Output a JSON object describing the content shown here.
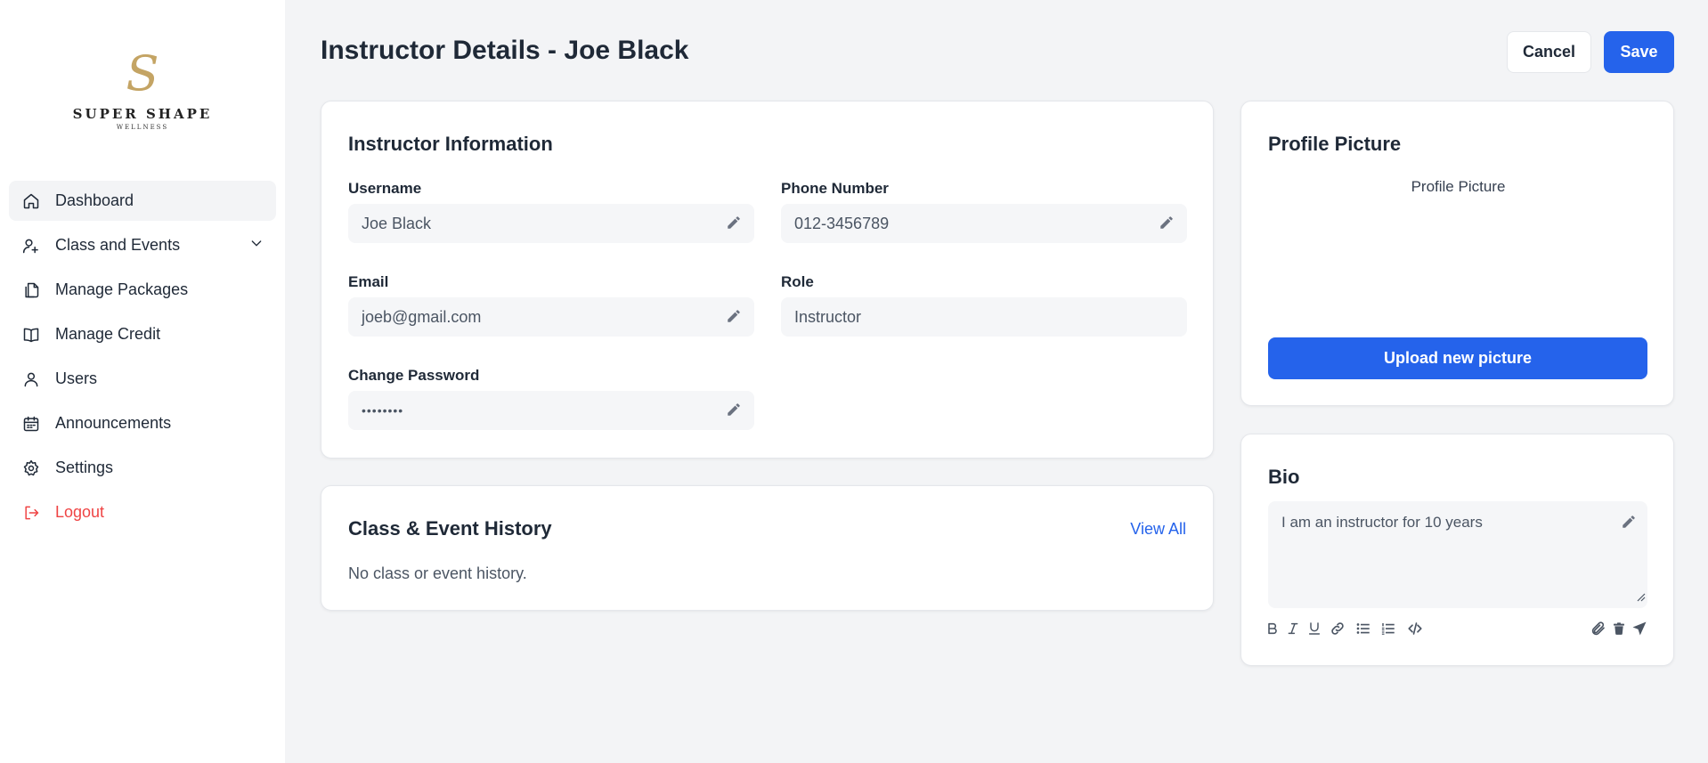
{
  "brand": {
    "mark": "S",
    "name": "SUPER SHAPE",
    "sub": "WELLNESS",
    "gold": "#c4a464"
  },
  "sidebar": {
    "items": [
      {
        "label": "Dashboard",
        "icon": "home-icon"
      },
      {
        "label": "Class and Events",
        "icon": "user-plus-icon"
      },
      {
        "label": "Manage Packages",
        "icon": "documents-icon"
      },
      {
        "label": "Manage Credit",
        "icon": "book-icon"
      },
      {
        "label": "Users",
        "icon": "user-icon"
      },
      {
        "label": "Announcements",
        "icon": "calendar-icon"
      },
      {
        "label": "Settings",
        "icon": "gear-icon"
      },
      {
        "label": "Logout",
        "icon": "logout-icon"
      }
    ]
  },
  "header": {
    "title": "Instructor Details - Joe Black",
    "cancel_label": "Cancel",
    "save_label": "Save"
  },
  "info": {
    "title": "Instructor Information",
    "username_label": "Username",
    "username_value": "Joe Black",
    "phone_label": "Phone Number",
    "phone_value": "012-3456789",
    "email_label": "Email",
    "email_value": "joeb@gmail.com",
    "role_label": "Role",
    "role_value": "Instructor",
    "password_label": "Change Password",
    "password_value": "••••••••"
  },
  "history": {
    "title": "Class & Event History",
    "view_all": "View All",
    "empty": "No class or event history."
  },
  "profile": {
    "title": "Profile Picture",
    "alt": "Profile Picture",
    "upload_label": "Upload new picture"
  },
  "bio": {
    "title": "Bio",
    "value": "I am an instructor for 10 years"
  },
  "colors": {
    "accent": "#2563eb",
    "danger": "#ef4444",
    "background": "#f3f4f6"
  }
}
